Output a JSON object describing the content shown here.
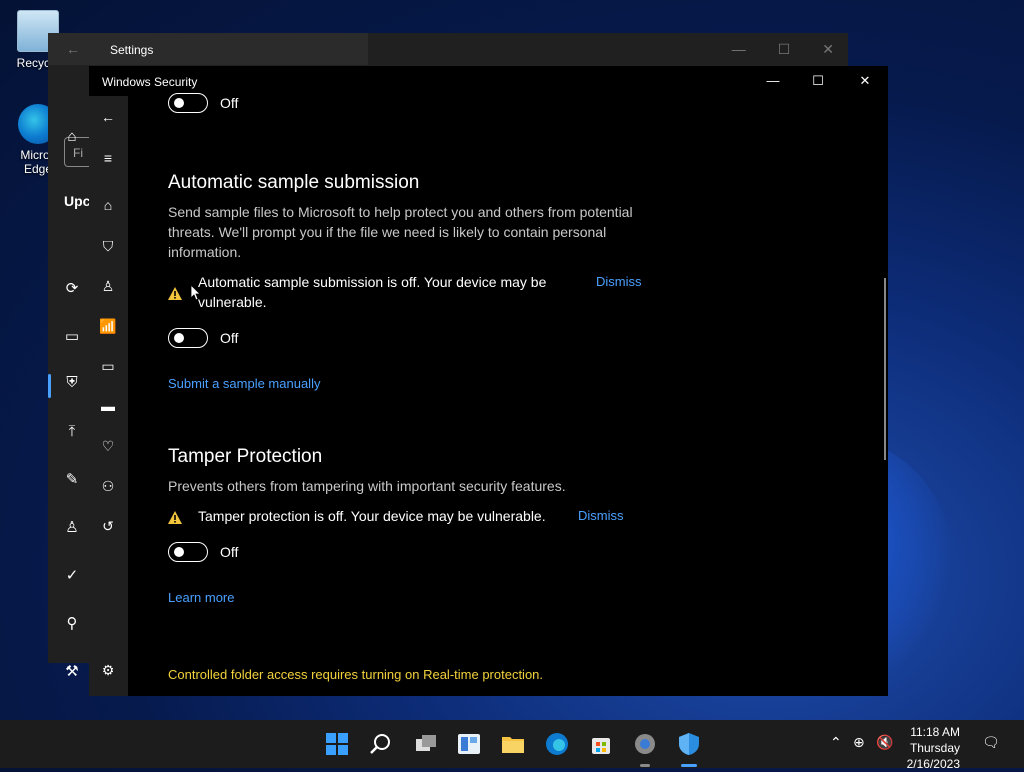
{
  "desktop": {
    "icons": [
      {
        "label": "Recycle",
        "icon": "recycle-bin-icon"
      },
      {
        "label": "Micros Edge",
        "icon": "edge-icon"
      }
    ]
  },
  "settings_window": {
    "title": "Settings",
    "search_placeholder": "Fi",
    "section_heading": "Upc"
  },
  "security_window": {
    "title": "Windows Security",
    "top_toggle": {
      "state": "Off"
    },
    "auto_sample": {
      "heading": "Automatic sample submission",
      "description": "Send sample files to Microsoft to help protect you and others from potential threats. We'll prompt you if the file we need is likely to contain personal information.",
      "warning": "Automatic sample submission is off. Your device may be vulnerable.",
      "dismiss": "Dismiss",
      "toggle_state": "Off",
      "link": "Submit a sample manually"
    },
    "tamper": {
      "heading": "Tamper Protection",
      "description": "Prevents others from tampering with important security features.",
      "warning": "Tamper protection is off. Your device may be vulnerable.",
      "dismiss": "Dismiss",
      "toggle_state": "Off",
      "link": "Learn more"
    },
    "controlled_folder_notice": "Controlled folder access requires turning on Real-time protection."
  },
  "taskbar": {
    "time": "11:18 AM",
    "day": "Thursday",
    "date": "2/16/2023"
  },
  "colors": {
    "accent": "#4aa0ff",
    "warning": "#f2c53d",
    "notice": "#f2d23c"
  }
}
